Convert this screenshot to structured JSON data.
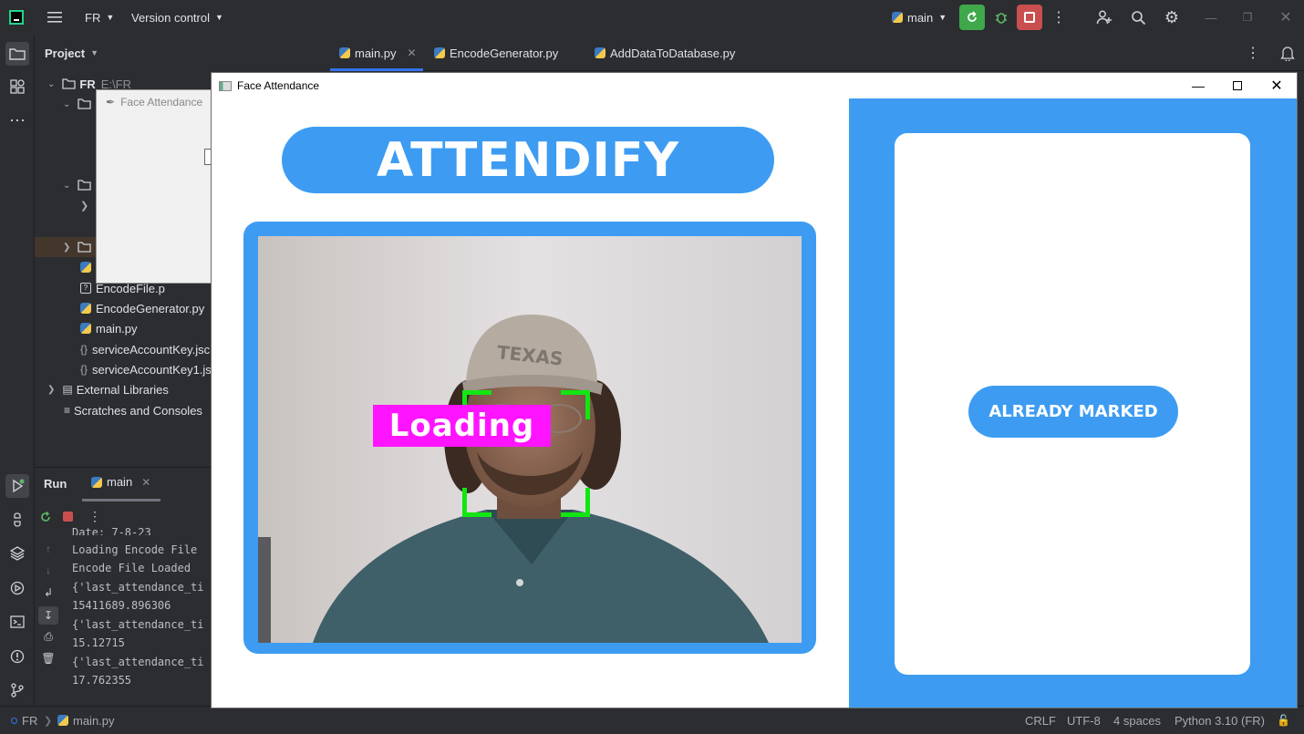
{
  "ide": {
    "project_name": "FR",
    "vcs_label": "Version control",
    "run_config": "main",
    "colors": {
      "run_green": "#3ea84a",
      "stop_red": "#c94f4f",
      "bg": "#2b2d30"
    }
  },
  "project_panel": {
    "title": "Project",
    "root_label": "FR",
    "root_path": "E:\\FR",
    "files": [
      "EncodeFile.p",
      "EncodeGenerator.py",
      "main.py",
      "serviceAccountKey.jsc",
      "serviceAccountKey1.js"
    ],
    "external_libraries": "External Libraries",
    "scratches": "Scratches and Consoles"
  },
  "editor_tabs": [
    {
      "label": "main.py"
    },
    {
      "label": "EncodeGenerator.py"
    },
    {
      "label": "AddDataToDatabase.py"
    }
  ],
  "run_panel": {
    "title": "Run",
    "tab": "main",
    "console": [
      "Date: 7-8-23",
      "Loading Encode File",
      "Encode File Loaded",
      "{'last_attendance_ti",
      "15411689.896306",
      "{'last_attendance_ti",
      "15.12715",
      "{'last_attendance_ti",
      "17.762355"
    ]
  },
  "status_bar": {
    "project": "FR",
    "file": "main.py",
    "line_ending": "CRLF",
    "encoding": "UTF-8",
    "indent": "4 spaces",
    "interpreter": "Python 3.10 (FR)"
  },
  "tk_window": {
    "title": "Face Attendance"
  },
  "face_window": {
    "title": "Face Attendance",
    "banner": "ATTENDIFY",
    "overlay_label": "Loading",
    "status_button": "ALREADY MARKED",
    "colors": {
      "accent_blue": "#3d9cf2",
      "loading_magenta": "#ff14ff",
      "detection_green": "#12e612"
    }
  }
}
